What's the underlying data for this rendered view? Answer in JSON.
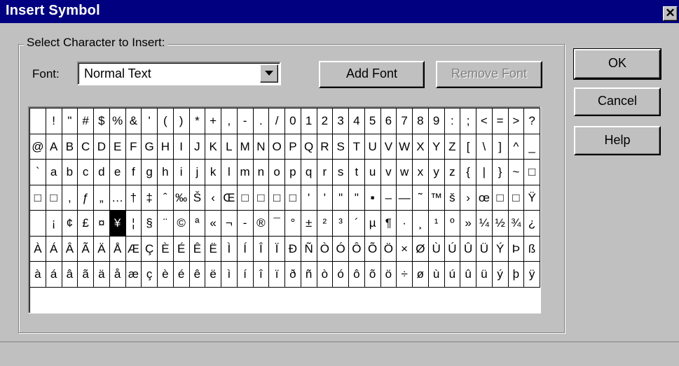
{
  "window": {
    "title": "Insert Symbol",
    "close_label": "✕"
  },
  "group": {
    "legend": "Select Character to Insert:"
  },
  "font": {
    "label": "Font:",
    "value": "Normal Text"
  },
  "buttons": {
    "add_font": "Add Font",
    "remove_font": "Remove Font",
    "ok": "OK",
    "cancel": "Cancel",
    "help": "Help"
  },
  "grid": {
    "selected_index": 133,
    "rows": [
      [
        " ",
        "!",
        "\"",
        "#",
        "$",
        "%",
        "&",
        "'",
        "(",
        ")",
        "*",
        "+",
        ",",
        "-",
        ".",
        "/",
        "0",
        "1",
        "2",
        "3",
        "4",
        "5",
        "6",
        "7",
        "8",
        "9",
        ":",
        ";"
      ],
      [
        "<",
        "=",
        ">",
        "?",
        "@",
        "A",
        "B",
        "C",
        "D",
        "E",
        "F",
        "G",
        "H",
        "I",
        "J",
        "K",
        "L",
        "M",
        "N",
        "O",
        "P",
        "Q",
        "R",
        "S",
        "T",
        "U",
        "V",
        "W"
      ],
      [
        "X",
        "Y",
        "Z",
        "[",
        "\\",
        "]",
        "^",
        "_",
        "`",
        "a",
        "b",
        "c",
        "d",
        "e",
        "f",
        "g",
        "h",
        "i",
        "j",
        "k",
        "l",
        "m",
        "n",
        "o",
        "p",
        "q",
        "r",
        "s"
      ],
      [
        "t",
        "u",
        "v",
        "w",
        "x",
        "y",
        "z",
        "{",
        "|",
        "}",
        "~",
        "□",
        "□",
        "□",
        ",",
        "ƒ",
        "„",
        "…",
        "†",
        "‡",
        "ˆ",
        "‰",
        "Š",
        "‹",
        "Œ",
        "□",
        "□",
        "□"
      ],
      [
        "□",
        "'",
        "'",
        "\"",
        "\"",
        "▪",
        "–",
        "—",
        "˜",
        "™",
        "š",
        "›",
        "œ",
        "□",
        "□",
        "Ÿ",
        " ",
        "¡",
        "¢",
        "£",
        "¤",
        "¥",
        "¦",
        "§",
        "¨",
        "©",
        "ª",
        "«"
      ],
      [
        "¬",
        "-",
        "®",
        "¯",
        "°",
        "±",
        "²",
        "³",
        "´",
        "µ",
        "¶",
        "·",
        "¸",
        "¹",
        "º",
        "»",
        "¼",
        "½",
        "¾",
        "¿",
        "À",
        "Á",
        "Â",
        "Ã",
        "Ä",
        "Å",
        "Æ",
        "Ç"
      ],
      [
        "È",
        "É",
        "Ê",
        "Ë",
        "Ì",
        "Í",
        "Î",
        "Ï",
        "Ð",
        "Ñ",
        "Ò",
        "Ó",
        "Ô",
        "Õ",
        "Ö",
        "×",
        "Ø",
        "Ù",
        "Ú",
        "Û",
        "Ü",
        "Ý",
        "Þ",
        "ß",
        "à",
        "á",
        "â",
        "ã"
      ],
      [
        "ä",
        "å",
        "æ",
        "ç",
        "è",
        "é",
        "ê",
        "ë",
        "ì",
        "í",
        "î",
        "ï",
        "ð",
        "ñ",
        "ò",
        "ó",
        "ô",
        "õ",
        "ö",
        "÷",
        "ø",
        "ù",
        "ú",
        "û",
        "ü",
        "ý",
        "þ",
        "ÿ"
      ]
    ]
  },
  "colors": {
    "titlebar": "#000080",
    "face": "#c0c0c0",
    "disabled_text": "#808080"
  }
}
